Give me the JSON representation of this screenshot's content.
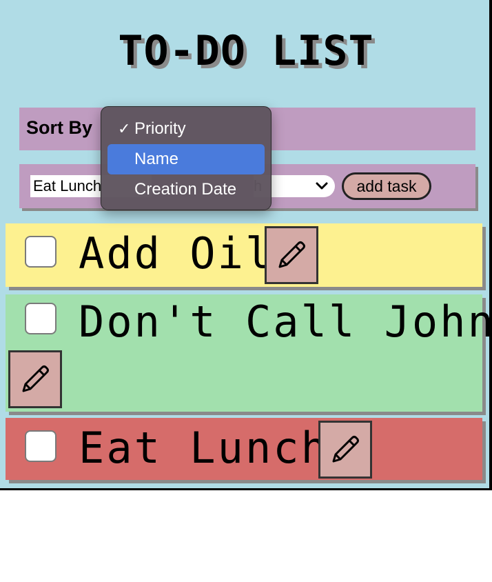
{
  "app": {
    "title": "TO-DO LIST"
  },
  "sort": {
    "label": "Sort By",
    "options": [
      "Priority",
      "Name",
      "Creation Date"
    ],
    "selected": "Priority",
    "highlighted": "Name"
  },
  "add_form": {
    "input_value": "Eat Lunch",
    "priority_value": "High",
    "priority_visible": "h",
    "add_button_label": "add task"
  },
  "tasks": [
    {
      "name": "Add Oil",
      "checked": false,
      "color": "#fdf190"
    },
    {
      "name": "Don't Call John",
      "checked": false,
      "color": "#a2e0ad"
    },
    {
      "name": "Eat Lunch",
      "checked": false,
      "color": "#d66c6a"
    }
  ],
  "icons": {
    "edit": "pencil-icon",
    "checkmark": "checkmark-icon",
    "chevron": "chevron-down-icon"
  },
  "colors": {
    "background": "#b0dce6",
    "panel": "#bf9cc0",
    "button": "#d4aaa6",
    "highlight": "#4a7bdc"
  }
}
